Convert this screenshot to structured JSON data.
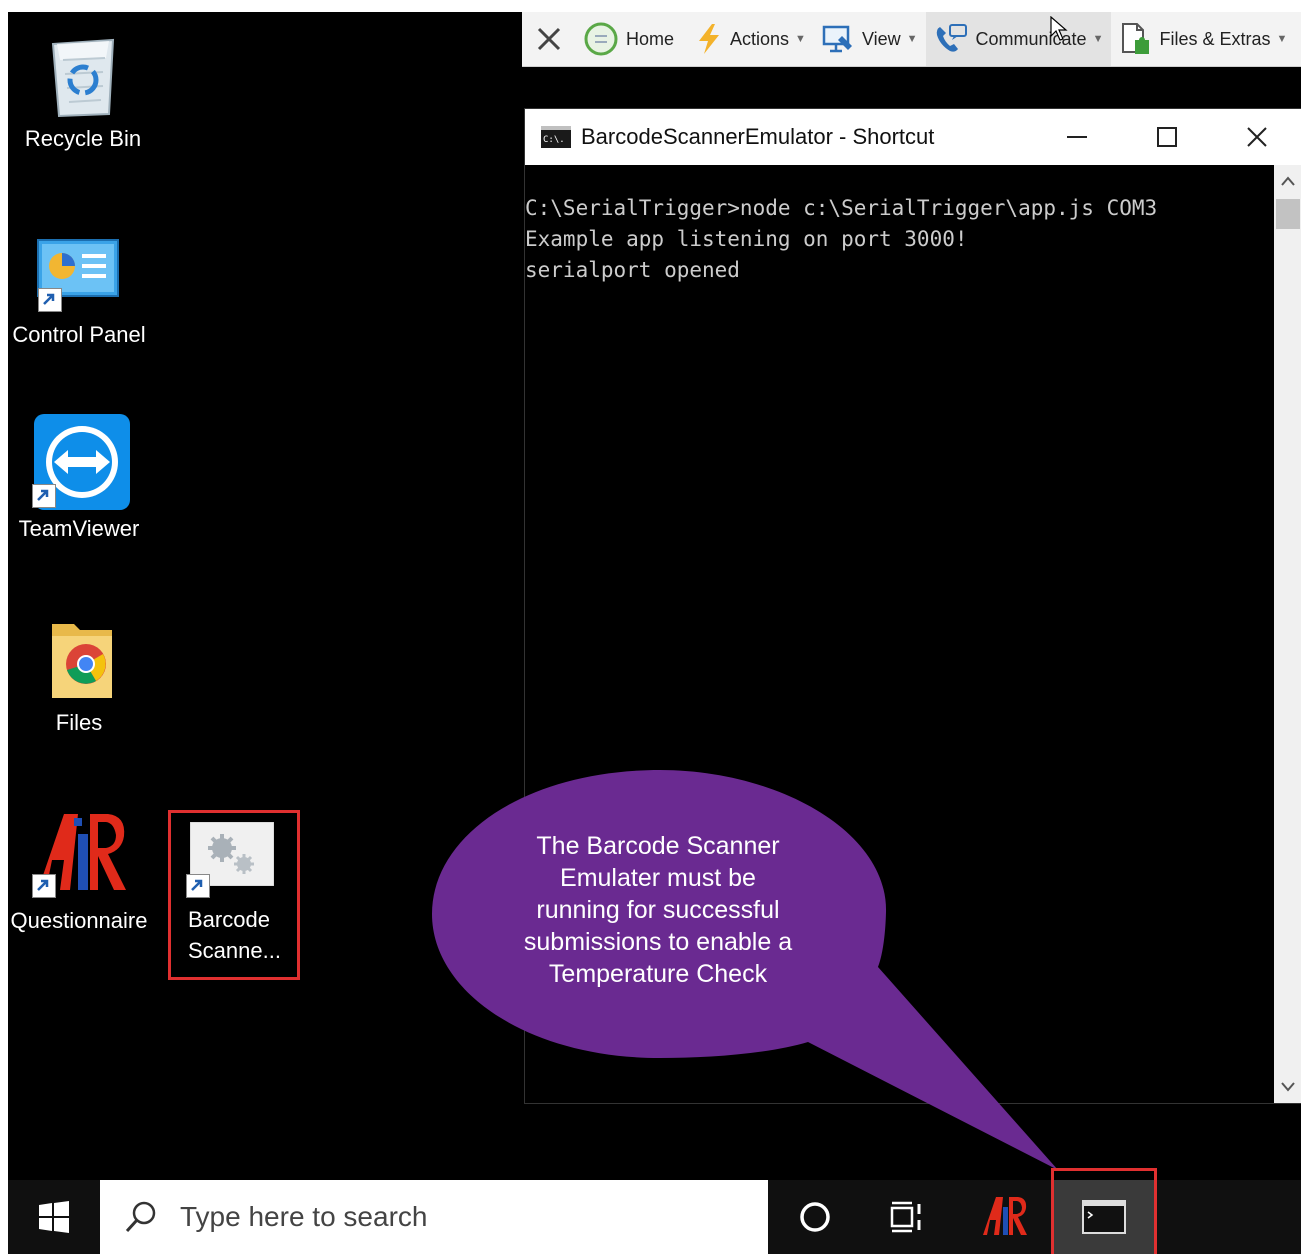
{
  "desktop": {
    "icons": [
      {
        "label": "Recycle Bin"
      },
      {
        "label": "Control Panel"
      },
      {
        "label": "TeamViewer"
      },
      {
        "label": "Files"
      },
      {
        "label": "Questionnaire"
      },
      {
        "label": "Barcode Scanne..."
      }
    ]
  },
  "remote_toolbar": {
    "items": [
      {
        "label": "Home"
      },
      {
        "label": "Actions"
      },
      {
        "label": "View"
      },
      {
        "label": "Communicate"
      },
      {
        "label": "Files & Extras"
      }
    ]
  },
  "console": {
    "title": "BarcodeScannerEmulator - Shortcut",
    "lines": [
      "C:\\SerialTrigger>node c:\\SerialTrigger\\app.js COM3",
      "Example app listening on port 3000!",
      "serialport opened"
    ]
  },
  "callout": {
    "lines": [
      "The Barcode Scanner",
      "Emulater must be",
      "running for successful",
      "submissions to enable a",
      "Temperature Check"
    ],
    "color": "#6a2a91"
  },
  "taskbar": {
    "search_placeholder": "Type here to search"
  },
  "colors": {
    "highlight": "#e03030",
    "desktop_bg": "#000000"
  }
}
